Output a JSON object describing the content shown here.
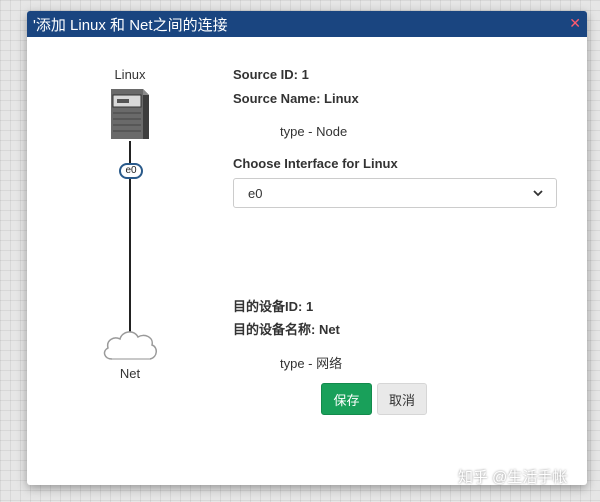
{
  "dialog": {
    "title": "'添加 Linux 和 Net之间的连接",
    "close_glyph": "✕"
  },
  "diagram": {
    "source_label": "Linux",
    "interface_badge": "e0",
    "target_label": "Net"
  },
  "source": {
    "id_line": "Source ID: 1",
    "name_line": "Source Name: Linux",
    "type_line": "type - Node"
  },
  "interface": {
    "label": "Choose Interface for Linux",
    "selected": "e0"
  },
  "target": {
    "id_line": "目的设备ID: 1",
    "name_line": "目的设备名称: Net",
    "type_line": "type - 网络"
  },
  "buttons": {
    "save_label": "保存",
    "cancel_label": "取消"
  },
  "watermark": "知乎 @生活手帐",
  "colors": {
    "titlebar": "#1a4580",
    "save_button": "#19a05a",
    "close_icon": "#ff5a6e"
  }
}
